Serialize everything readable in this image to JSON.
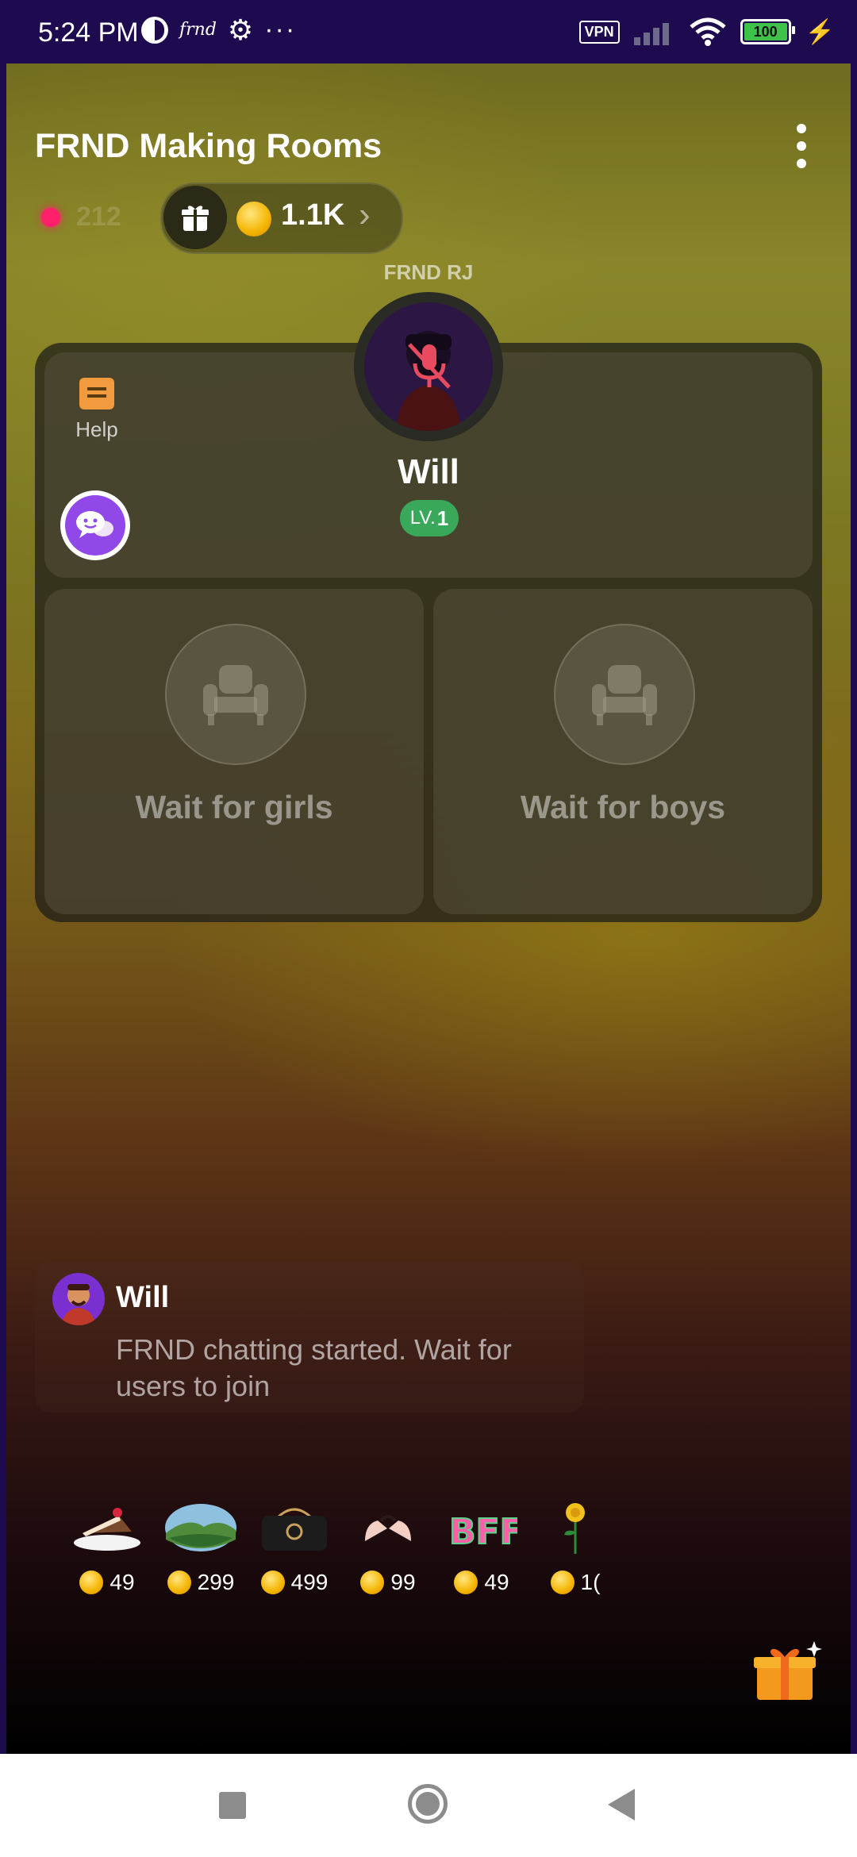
{
  "status_bar": {
    "time": "5:24 PM",
    "app_label": "frnd",
    "vpn": "VPN",
    "battery": "100"
  },
  "room": {
    "title": "FRND Making Rooms",
    "live_count": "212",
    "coins": "1.1K"
  },
  "host": {
    "role_label": "FRND RJ",
    "name": "Will",
    "level_prefix": "LV.",
    "level": "1"
  },
  "help_label": "Help",
  "seats": [
    {
      "label": "Wait for girls"
    },
    {
      "label": "Wait for boys"
    }
  ],
  "message": {
    "name": "Will",
    "text": "FRND chatting started. Wait for users to join"
  },
  "gifts": [
    {
      "name": "cake-gift",
      "price": "49"
    },
    {
      "name": "landscape-gift",
      "price": "299"
    },
    {
      "name": "handbag-gift",
      "price": "499"
    },
    {
      "name": "pinky-promise-gift",
      "price": "99"
    },
    {
      "name": "bff-gift",
      "price": "49"
    },
    {
      "name": "rose-gift",
      "price": "1("
    }
  ],
  "colors": {
    "status_bar": "#1e0a4f",
    "live_dot": "#ff1f6a",
    "level_badge": "#3aa85a",
    "chat_button": "#9148e8",
    "help_icon": "#f19a3e"
  }
}
